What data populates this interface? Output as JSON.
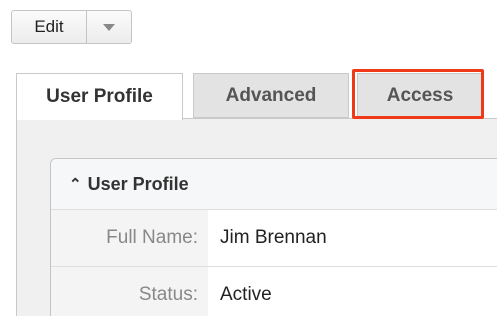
{
  "toolbar": {
    "edit_label": "Edit",
    "dropdown_icon": "caret-down-icon"
  },
  "tabs": [
    {
      "label": "User Profile",
      "active": true
    },
    {
      "label": "Advanced",
      "active": false
    },
    {
      "label": "Access",
      "active": false,
      "highlighted": true
    }
  ],
  "panel": {
    "section_title": "User Profile",
    "collapse_icon": "double-chevron-up-icon",
    "fields": [
      {
        "label": "Full Name:",
        "value": "Jim Brennan"
      },
      {
        "label": "Status:",
        "value": "Active"
      }
    ]
  },
  "colors": {
    "highlight": "#f03a17",
    "inactive_tab": "#e3e3e3",
    "panel_bg": "#f0f0f0"
  }
}
